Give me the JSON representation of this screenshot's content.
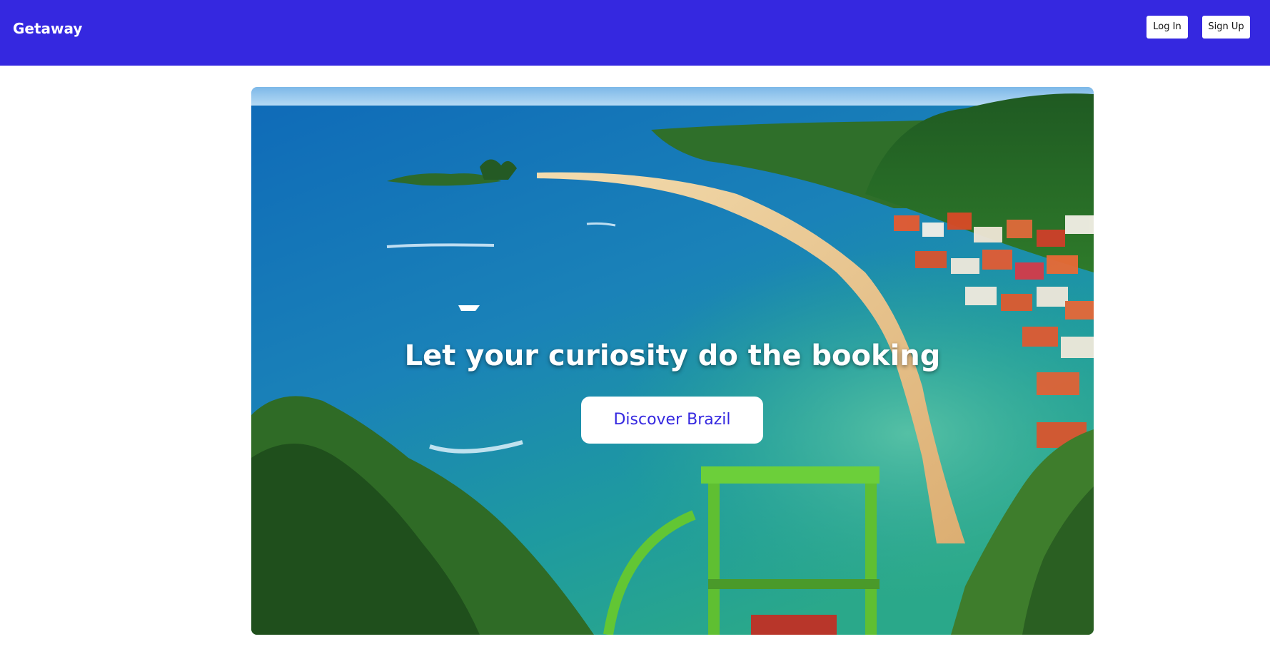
{
  "nav": {
    "brand": "Getaway",
    "login_label": "Log In",
    "signup_label": "Sign Up"
  },
  "hero": {
    "image_description_icon": "tropical-beach-photo",
    "title": "Let your curiosity do the booking",
    "cta_label": "Discover Brazil"
  },
  "colors": {
    "brand": "#3528e0",
    "background": "#ffffff",
    "button_bg": "#ffffff",
    "cta_text": "#3528e0"
  }
}
